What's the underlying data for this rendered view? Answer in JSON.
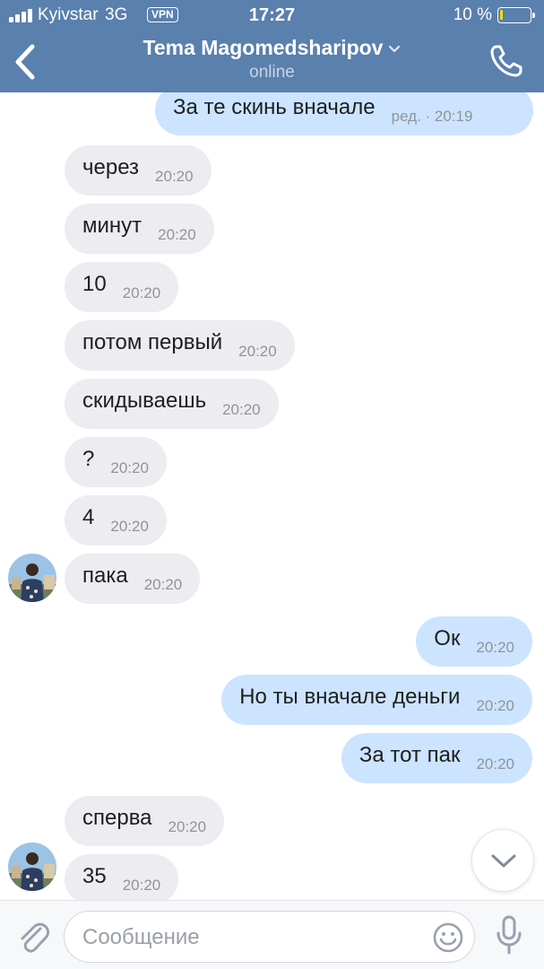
{
  "status_bar": {
    "carrier": "Kyivstar",
    "network": "3G",
    "vpn": "VPN",
    "time": "17:27",
    "battery": "10 %",
    "battery_level": 0.1
  },
  "header": {
    "title": "Tema Magomedsharipov",
    "status": "online",
    "background_color": "#5a80ad"
  },
  "messages": [
    {
      "direction": "out",
      "text": "За те скинь вначале",
      "time": "ред. · 20:19"
    },
    {
      "direction": "in",
      "text": "через",
      "time": "20:20"
    },
    {
      "direction": "in",
      "text": "минут",
      "time": "20:20"
    },
    {
      "direction": "in",
      "text": "10",
      "time": "20:20"
    },
    {
      "direction": "in",
      "text": "потом первый",
      "time": "20:20"
    },
    {
      "direction": "in",
      "text": "скидываешь",
      "time": "20:20"
    },
    {
      "direction": "in",
      "text": "?",
      "time": "20:20"
    },
    {
      "direction": "in",
      "text": "4",
      "time": "20:20"
    },
    {
      "direction": "in",
      "text": "пака",
      "time": "20:20"
    },
    {
      "direction": "out",
      "text": "Ок",
      "time": "20:20"
    },
    {
      "direction": "out",
      "text": "Но ты вначале деньги",
      "time": "20:20"
    },
    {
      "direction": "out",
      "text": "За тот пак",
      "time": "20:20"
    },
    {
      "direction": "in",
      "text": "сперва",
      "time": "20:20"
    },
    {
      "direction": "in",
      "text": "35",
      "time": "20:20"
    }
  ],
  "composer": {
    "placeholder": "Сообщение"
  },
  "icons": {
    "back": "chevron-left-icon",
    "call": "phone-icon",
    "attach": "paperclip-icon",
    "emoji": "smiley-icon",
    "mic": "microphone-icon",
    "scroll_down": "chevron-down-icon"
  },
  "colors": {
    "incoming_bubble": "#ececf1",
    "outgoing_bubble": "#cce4ff",
    "battery_fill": "#f5d90a"
  }
}
